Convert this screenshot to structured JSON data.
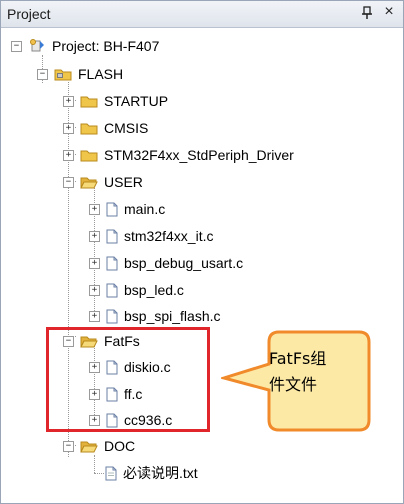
{
  "panel": {
    "title": "Project"
  },
  "tree": {
    "project": "Project: BH-F407",
    "target": "FLASH",
    "groups": {
      "startup": "STARTUP",
      "cmsis": "CMSIS",
      "driver": "STM32F4xx_StdPeriph_Driver",
      "user": "USER",
      "fatfs": "FatFs",
      "doc": "DOC"
    },
    "user_files": [
      "main.c",
      "stm32f4xx_it.c",
      "bsp_debug_usart.c",
      "bsp_led.c",
      "bsp_spi_flash.c"
    ],
    "fatfs_files": [
      "diskio.c",
      "ff.c",
      "cc936.c"
    ],
    "doc_files": [
      "必读说明.txt"
    ]
  },
  "annotation": {
    "line1": "FatFs组",
    "line2": "件文件"
  },
  "colors": {
    "highlight": "#e0262b",
    "callout_border": "#f08a2a",
    "callout_fill": "#fde9a6"
  }
}
